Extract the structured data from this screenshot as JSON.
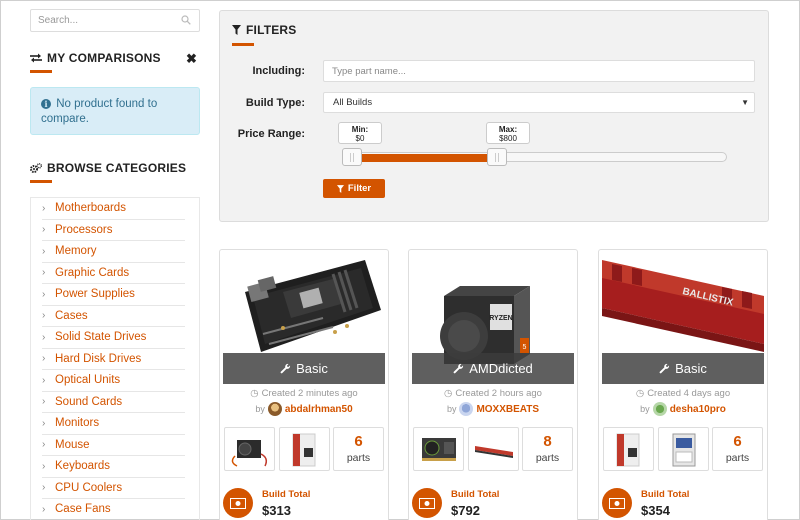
{
  "search": {
    "placeholder": "Search..."
  },
  "comparisons": {
    "title": "MY COMPARISONS",
    "empty_message": "No product found to compare."
  },
  "categories": {
    "title": "BROWSE CATEGORIES",
    "items": [
      "Motherboards",
      "Processors",
      "Memory",
      "Graphic Cards",
      "Power Supplies",
      "Cases",
      "Solid State Drives",
      "Hard Disk Drives",
      "Optical Units",
      "Sound Cards",
      "Monitors",
      "Mouse",
      "Keyboards",
      "CPU Coolers",
      "Case Fans"
    ]
  },
  "filters": {
    "title": "FILTERS",
    "including_label": "Including:",
    "including_placeholder": "Type part name...",
    "build_type_label": "Build Type:",
    "build_type_value": "All Builds",
    "price_label": "Price Range:",
    "min_label": "Min:",
    "min_value": "$0",
    "max_label": "Max:",
    "max_value": "$800",
    "slider_min_fraction": 0.0,
    "slider_max_fraction": 0.4,
    "button_label": "Filter"
  },
  "builds": [
    {
      "name": "Basic",
      "created": "Created 2 minutes ago",
      "by": "by",
      "user": "abdalrhman50",
      "parts_count": "6",
      "parts_label": "parts",
      "total_label": "Build Total",
      "total": "$313"
    },
    {
      "name": "AMDdicted",
      "created": "Created 2 hours ago",
      "by": "by",
      "user": "MOXXBEATS",
      "parts_count": "8",
      "parts_label": "parts",
      "total_label": "Build Total",
      "total": "$792",
      "cpu_brand": "RYZEN",
      "cpu_model": "5"
    },
    {
      "name": "Basic",
      "created": "Created 4 days ago",
      "by": "by",
      "user": "desha10pro",
      "parts_count": "6",
      "parts_label": "parts",
      "total_label": "Build Total",
      "total": "$354",
      "ram_brand": "BALLISTIX"
    }
  ],
  "colors": {
    "accent": "#d35400",
    "info_bg": "#d9edf7",
    "info_text": "#31708f"
  }
}
